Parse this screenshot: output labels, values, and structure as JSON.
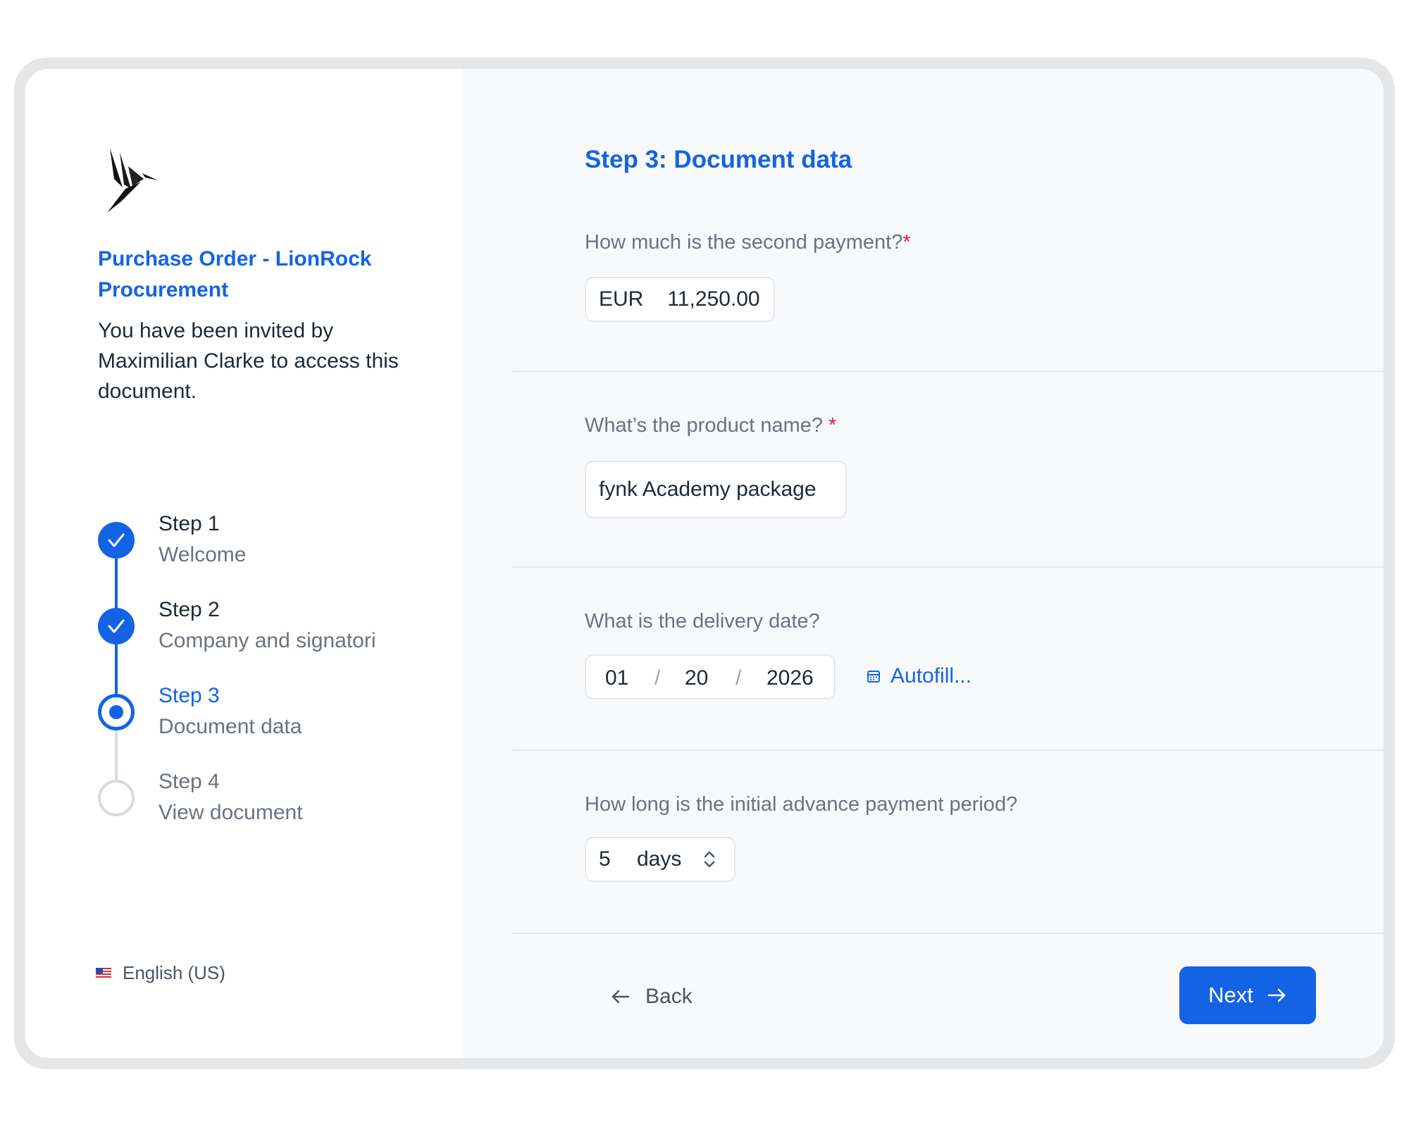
{
  "document": {
    "title": "Purchase Order - LionRock Procurement",
    "invite_text": "You have been invited by Maximilian Clarke to access this document."
  },
  "steps": [
    {
      "name": "Step 1",
      "description": "Welcome",
      "status": "completed"
    },
    {
      "name": "Step 2",
      "description": "Company and signatori",
      "status": "completed"
    },
    {
      "name": "Step 3",
      "description": "Document data",
      "status": "current"
    },
    {
      "name": "Step 4",
      "description": "View document",
      "status": "upcoming"
    }
  ],
  "language": {
    "label": "English (US)",
    "flag_icon": "us-flag-icon"
  },
  "form": {
    "title": "Step 3: Document data",
    "required_marker": "*",
    "payment": {
      "question": "How much is the second payment?",
      "currency": "EUR",
      "amount": "11,250.00"
    },
    "product": {
      "question": "What’s the product name? ",
      "value": "fynk Academy package"
    },
    "delivery": {
      "question": "What is the delivery date?",
      "month": "01",
      "day": "20",
      "year": "2026",
      "separator": "/",
      "autofill_label": "Autofill..."
    },
    "advance_period": {
      "question": "How long is the initial advance payment period?",
      "value": "5",
      "unit": "days"
    }
  },
  "navigation": {
    "back_label": "Back",
    "next_label": "Next"
  },
  "colors": {
    "accent": "#1463e5",
    "required": "#e11d2e",
    "muted_text": "#6b7280"
  }
}
